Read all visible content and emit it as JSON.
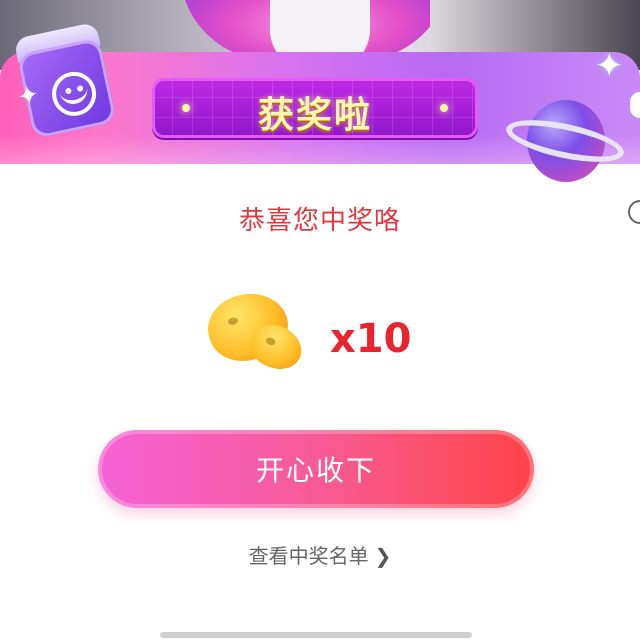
{
  "banner": {
    "title": "获奖啦"
  },
  "dialog": {
    "congrats_text": "恭喜您中奖咯",
    "prize": {
      "icon": "golden-beans-icon",
      "count_text": "x10"
    },
    "accept_button_label": "开心收下",
    "view_winners_label": "查看中奖名单",
    "view_winners_chevron": "❯"
  },
  "colors": {
    "accent_red": "#e0383c",
    "button_gradient_start": "#f562d6",
    "button_gradient_end": "#ff4348",
    "banner_purple": "#b86af3"
  }
}
